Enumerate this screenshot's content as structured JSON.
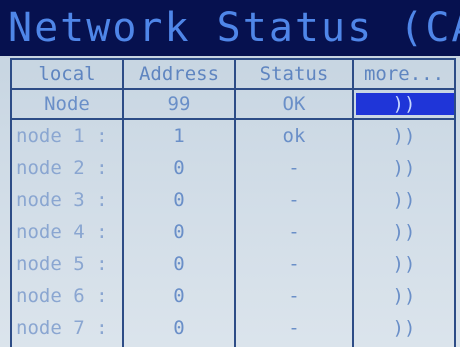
{
  "title": "Network Status (CAN)",
  "columns": [
    "local",
    "Address",
    "Status",
    "more..."
  ],
  "local_row": {
    "name": "Node",
    "address": "99",
    "status": "OK",
    "more": "))"
  },
  "nodes": [
    {
      "label": "node 1 :",
      "address": "1",
      "status": "ok",
      "more": "))"
    },
    {
      "label": "node 2 :",
      "address": "0",
      "status": "-",
      "more": "))"
    },
    {
      "label": "node 3 :",
      "address": "0",
      "status": "-",
      "more": "))"
    },
    {
      "label": "node 4 :",
      "address": "0",
      "status": "-",
      "more": "))"
    },
    {
      "label": "node 5 :",
      "address": "0",
      "status": "-",
      "more": "))"
    },
    {
      "label": "node 6 :",
      "address": "0",
      "status": "-",
      "more": "))"
    },
    {
      "label": "node 7 :",
      "address": "0",
      "status": "-",
      "more": "))"
    }
  ],
  "colors": {
    "title_bg": "#06114f",
    "title_text": "#4f86e8",
    "selection": "#1f35d8",
    "grid_line": "#2d4c86"
  }
}
